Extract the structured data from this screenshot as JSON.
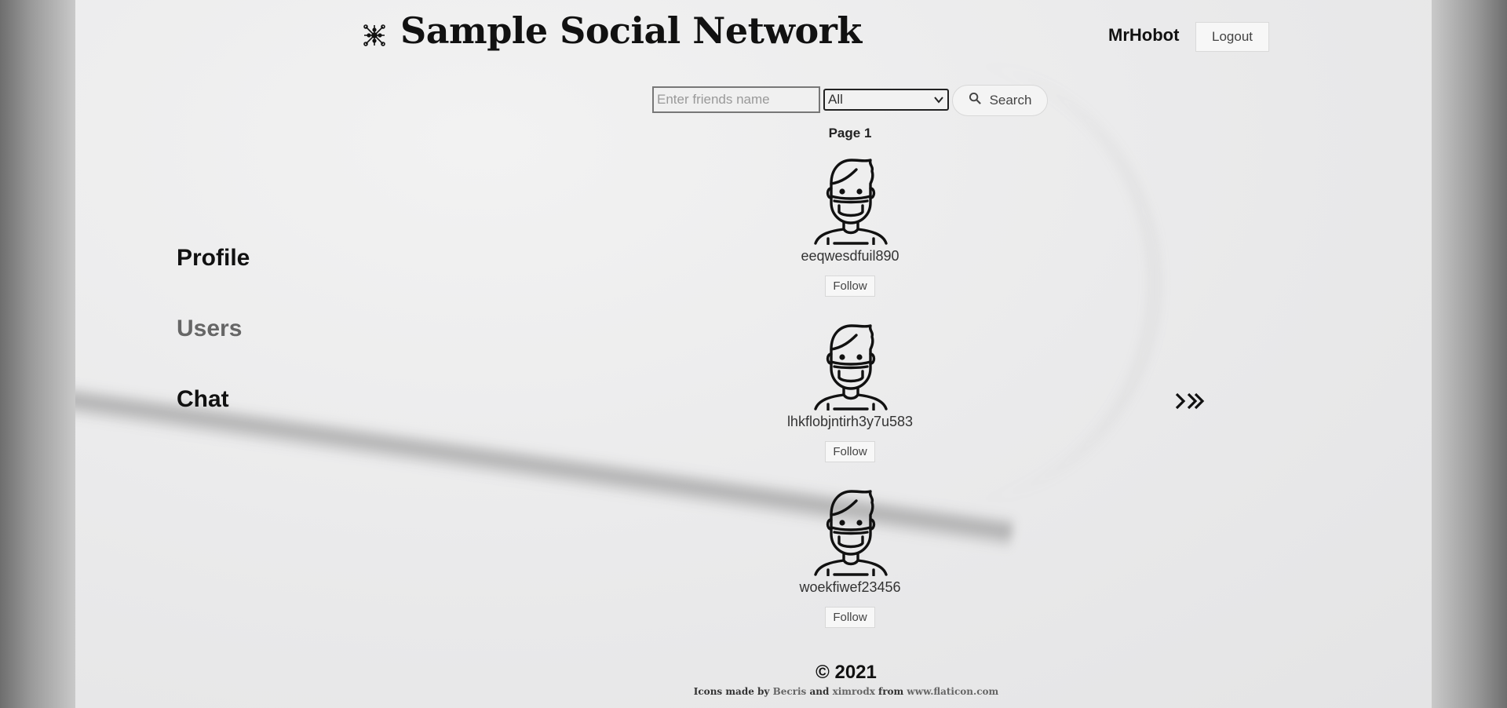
{
  "header": {
    "logo_icon": "network-icon",
    "title": "Sample Social Network",
    "username": "MrHobot",
    "logout_label": "Logout"
  },
  "search": {
    "placeholder": "Enter friends name",
    "value": "",
    "filter_selected": "All",
    "button_label": "Search",
    "button_icon": "magnifier-icon"
  },
  "pagination": {
    "page_label": "Page 1",
    "next_icon": "double-chevron-right-icon"
  },
  "sidebar": {
    "items": [
      {
        "label": "Profile"
      },
      {
        "label": "Users"
      },
      {
        "label": "Chat"
      }
    ],
    "active_color": "#666666"
  },
  "users": [
    {
      "name": "eeqwesdfuil890",
      "follow_label": "Follow",
      "avatar_icon": "masked-person-icon"
    },
    {
      "name": "lhkflobjntirh3y7u583",
      "follow_label": "Follow",
      "avatar_icon": "masked-person-icon"
    },
    {
      "name": "woekfiwef23456",
      "follow_label": "Follow",
      "avatar_icon": "masked-person-icon"
    }
  ],
  "footer": {
    "copyright": "© 2021",
    "credits_prefix": "Icons made by",
    "author1": "Becris",
    "and": "and",
    "author2": "ximrodx",
    "from": "from",
    "site": "www.flaticon.com"
  }
}
